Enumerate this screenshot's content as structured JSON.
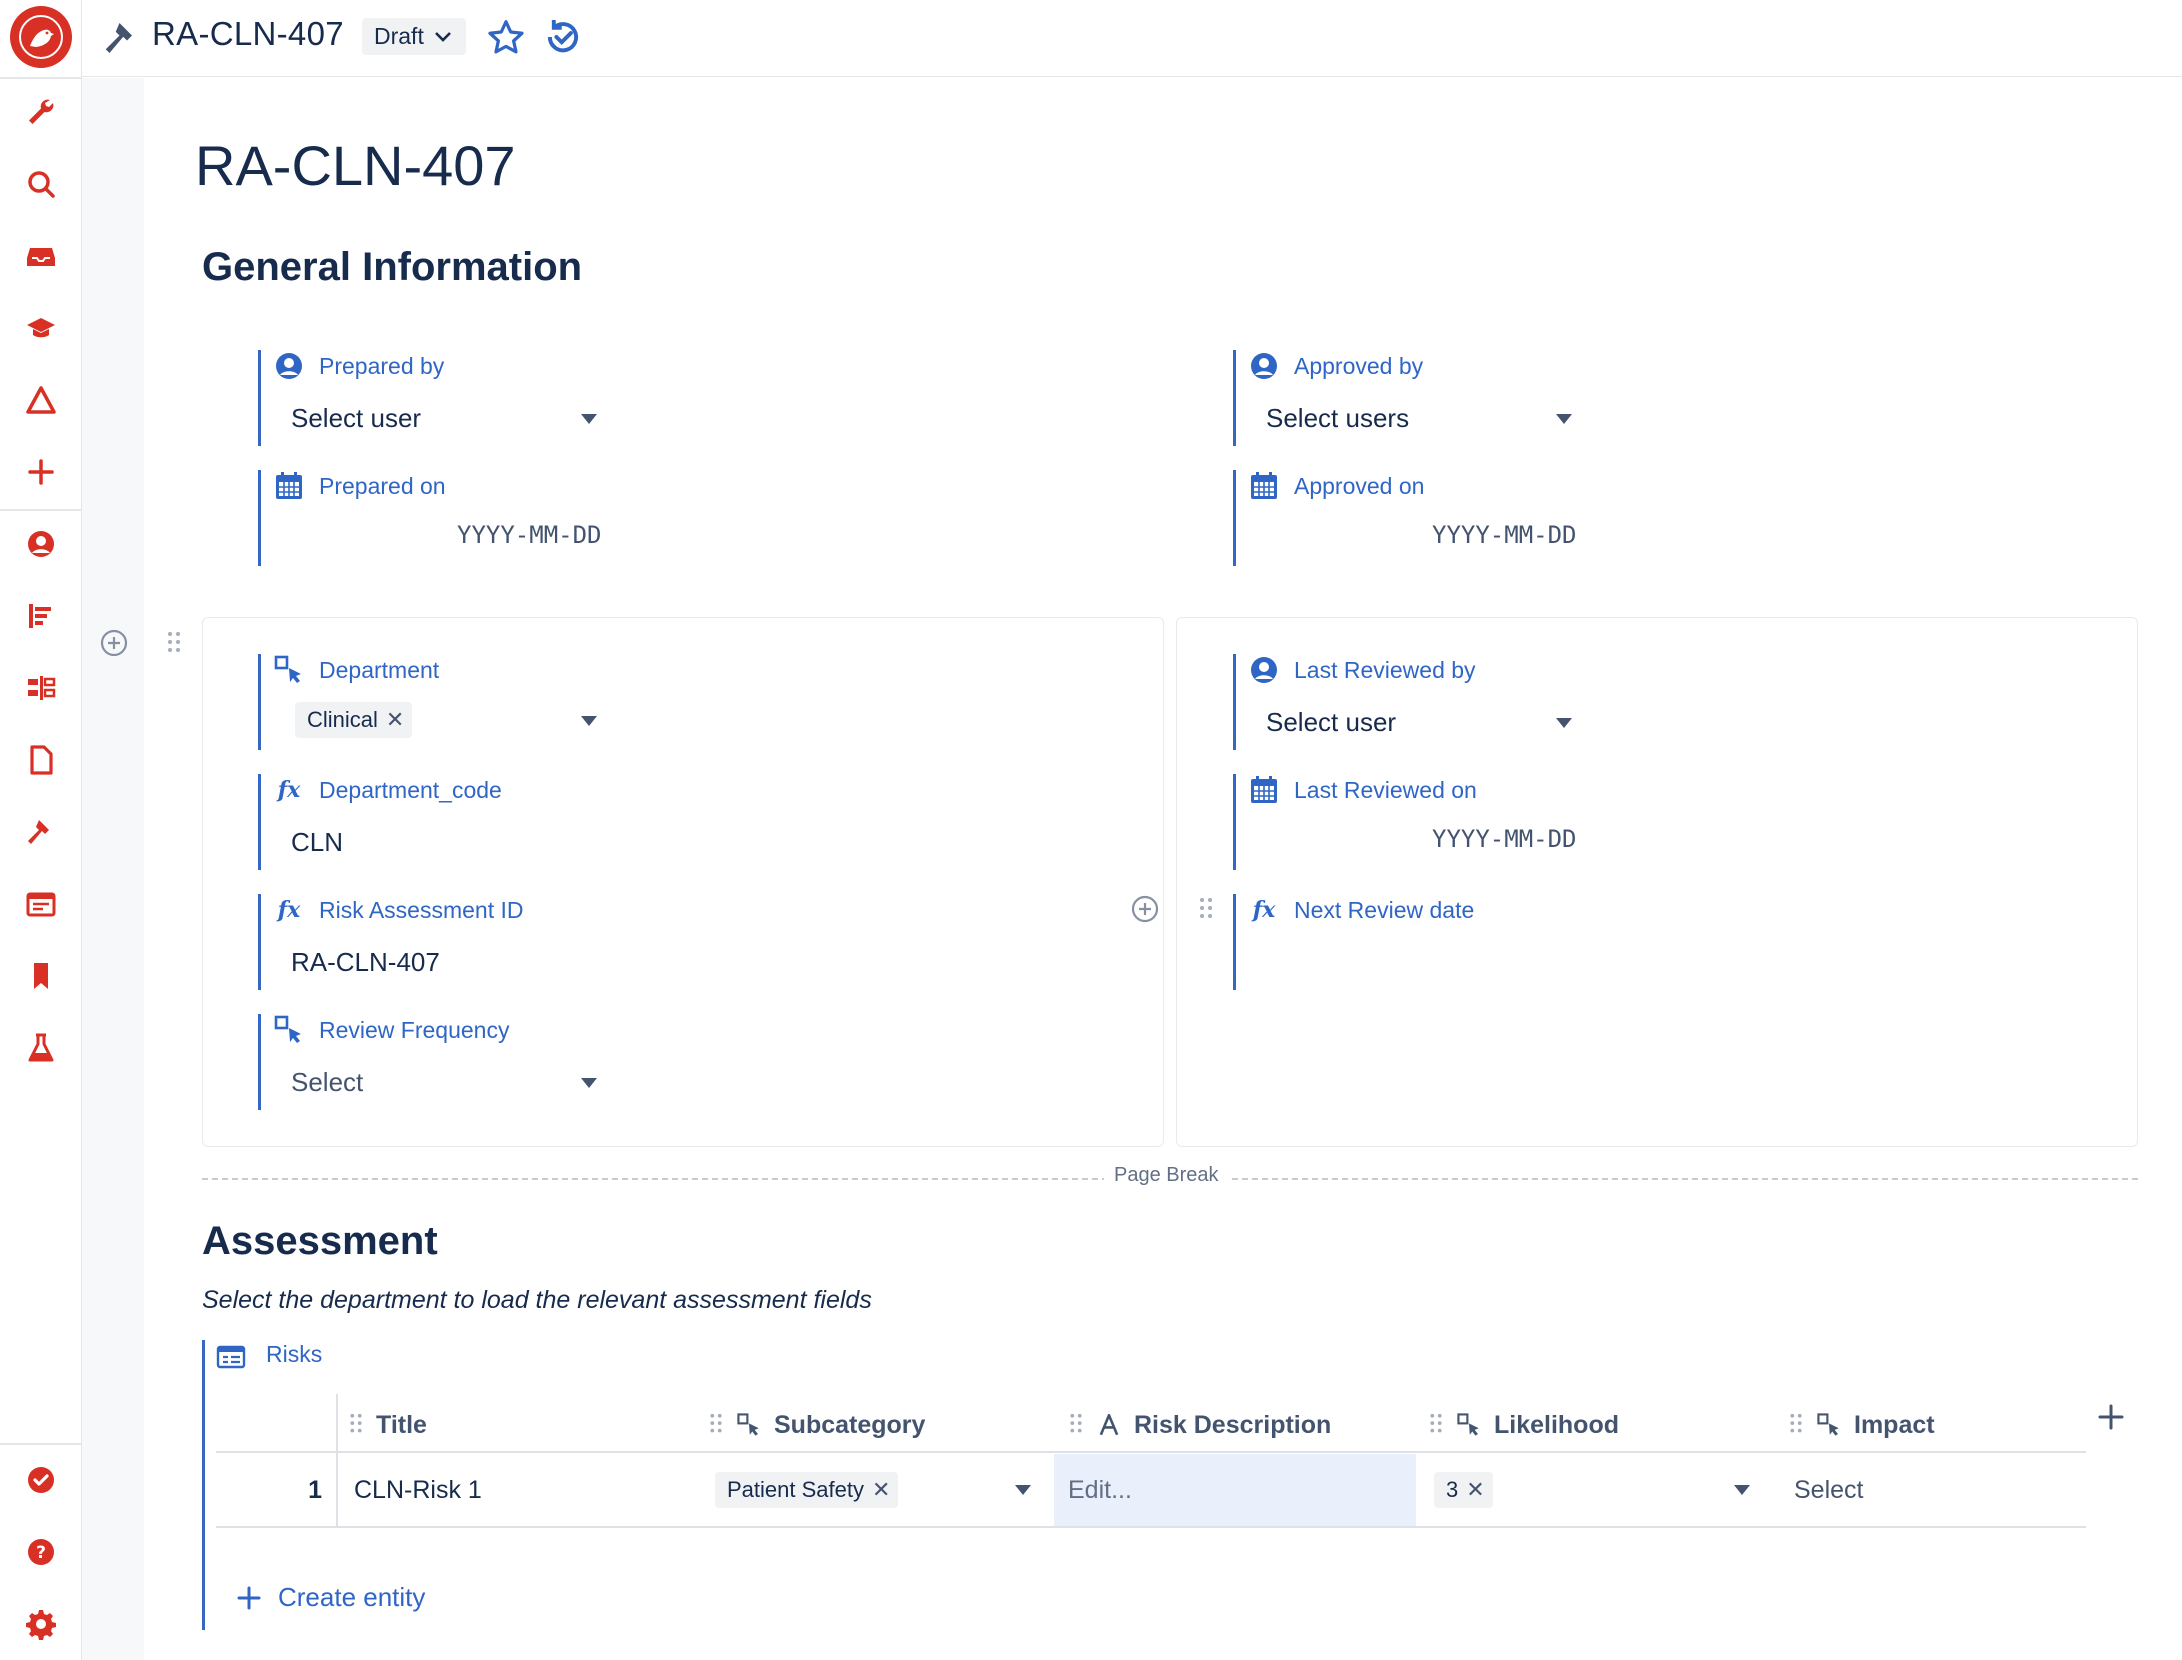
{
  "topbar": {
    "doc_id": "RA-CLN-407",
    "status": "Draft"
  },
  "page": {
    "title": "RA-CLN-407"
  },
  "general": {
    "title": "General Information",
    "prepared_by": {
      "label": "Prepared by",
      "value": "Select user"
    },
    "prepared_on": {
      "label": "Prepared on",
      "placeholder": "YYYY-MM-DD"
    },
    "approved_by": {
      "label": "Approved by",
      "value": "Select users"
    },
    "approved_on": {
      "label": "Approved on",
      "placeholder": "YYYY-MM-DD"
    },
    "department": {
      "label": "Department",
      "chip": "Clinical"
    },
    "department_code": {
      "label": "Department_code",
      "value": "CLN"
    },
    "risk_assessment_id": {
      "label": "Risk Assessment ID",
      "value": "RA-CLN-407"
    },
    "review_frequency": {
      "label": "Review Frequency",
      "value": "Select"
    },
    "last_reviewed_by": {
      "label": "Last Reviewed by",
      "value": "Select user"
    },
    "last_reviewed_on": {
      "label": "Last Reviewed on",
      "placeholder": "YYYY-MM-DD"
    },
    "next_review_date": {
      "label": "Next Review date"
    }
  },
  "page_break": "Page Break",
  "assessment": {
    "title": "Assessment",
    "instruction": "Select the department to load the relevant assessment fields",
    "table_label": "Risks",
    "columns": [
      "Title",
      "Subcategory",
      "Risk Description",
      "Likelihood",
      "Impact"
    ],
    "rows": [
      {
        "num": "1",
        "title": "CLN-Risk 1",
        "subcategory": "Patient Safety",
        "description": "Edit...",
        "likelihood": "3",
        "impact": "Select"
      }
    ],
    "create_label": "Create entity"
  },
  "colors": {
    "brand": "#d93025",
    "accent": "#2f66c6"
  }
}
